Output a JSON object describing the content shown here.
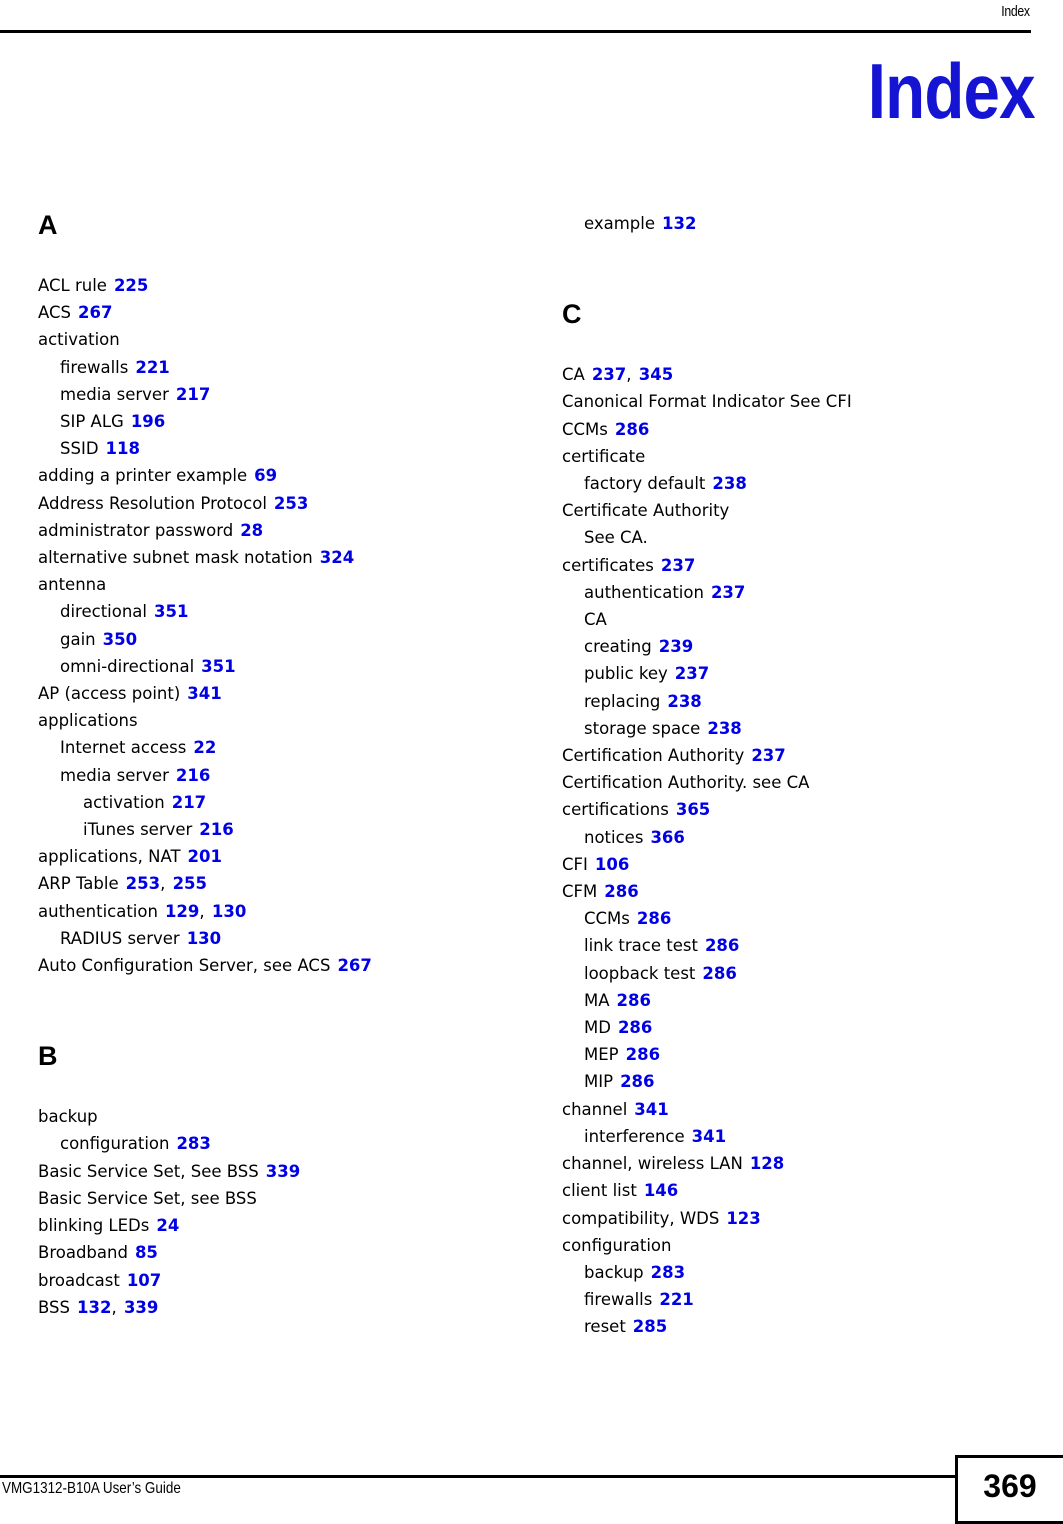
{
  "header": {
    "running_title": "Index"
  },
  "title": "Index",
  "footer": {
    "guide_name": "VMG1312-B10A User’s Guide",
    "page_number": "369"
  },
  "columns": [
    {
      "name": "left-column",
      "groups": [
        {
          "letter": "A",
          "first": true,
          "entries": [
            {
              "level": 1,
              "term": "ACL rule",
              "pages": [
                "225"
              ]
            },
            {
              "level": 1,
              "term": "ACS",
              "pages": [
                "267"
              ]
            },
            {
              "level": 1,
              "term": "activation",
              "pages": []
            },
            {
              "level": 2,
              "term": "firewalls",
              "pages": [
                "221"
              ]
            },
            {
              "level": 2,
              "term": "media server",
              "pages": [
                "217"
              ]
            },
            {
              "level": 2,
              "term": "SIP ALG",
              "pages": [
                "196"
              ]
            },
            {
              "level": 2,
              "term": "SSID",
              "pages": [
                "118"
              ]
            },
            {
              "level": 1,
              "term": "adding a printer example",
              "pages": [
                "69"
              ]
            },
            {
              "level": 1,
              "term": "Address Resolution Protocol",
              "pages": [
                "253"
              ]
            },
            {
              "level": 1,
              "term": "administrator password",
              "pages": [
                "28"
              ]
            },
            {
              "level": 1,
              "term": "alternative subnet mask notation",
              "pages": [
                "324"
              ]
            },
            {
              "level": 1,
              "term": "antenna",
              "pages": []
            },
            {
              "level": 2,
              "term": "directional",
              "pages": [
                "351"
              ]
            },
            {
              "level": 2,
              "term": "gain",
              "pages": [
                "350"
              ]
            },
            {
              "level": 2,
              "term": "omni-directional",
              "pages": [
                "351"
              ]
            },
            {
              "level": 1,
              "term": "AP (access point)",
              "pages": [
                "341"
              ]
            },
            {
              "level": 1,
              "term": "applications",
              "pages": []
            },
            {
              "level": 2,
              "term": "Internet access",
              "pages": [
                "22"
              ]
            },
            {
              "level": 2,
              "term": "media server",
              "pages": [
                "216"
              ]
            },
            {
              "level": 3,
              "term": "activation",
              "pages": [
                "217"
              ]
            },
            {
              "level": 3,
              "term": "iTunes server",
              "pages": [
                "216"
              ]
            },
            {
              "level": 1,
              "term": "applications, NAT",
              "pages": [
                "201"
              ]
            },
            {
              "level": 1,
              "term": "ARP Table",
              "pages": [
                "253",
                "255"
              ]
            },
            {
              "level": 1,
              "term": "authentication",
              "pages": [
                "129",
                "130"
              ]
            },
            {
              "level": 2,
              "term": "RADIUS server",
              "pages": [
                "130"
              ]
            },
            {
              "level": 1,
              "term": "Auto Configuration Server, see ACS",
              "pages": [
                "267"
              ]
            }
          ]
        },
        {
          "letter": "B",
          "first": false,
          "entries": [
            {
              "level": 1,
              "term": "backup",
              "pages": []
            },
            {
              "level": 2,
              "term": "configuration",
              "pages": [
                "283"
              ]
            },
            {
              "level": 1,
              "term": "Basic Service Set, See BSS",
              "pages": [
                "339"
              ]
            },
            {
              "level": 1,
              "term": "Basic Service Set, see BSS",
              "pages": []
            },
            {
              "level": 1,
              "term": "blinking LEDs",
              "pages": [
                "24"
              ]
            },
            {
              "level": 1,
              "term": "Broadband",
              "pages": [
                "85"
              ]
            },
            {
              "level": 1,
              "term": "broadcast",
              "pages": [
                "107"
              ]
            },
            {
              "level": 1,
              "term": "BSS",
              "pages": [
                "132",
                "339"
              ]
            }
          ]
        }
      ]
    },
    {
      "name": "right-column",
      "groups": [
        {
          "letter": "",
          "first": true,
          "entries": [
            {
              "level": 2,
              "term": "example",
              "pages": [
                "132"
              ]
            }
          ]
        },
        {
          "letter": "C",
          "first": false,
          "entries": [
            {
              "level": 1,
              "term": "CA",
              "pages": [
                "237",
                "345"
              ]
            },
            {
              "level": 1,
              "term": "Canonical Format Indicator See CFI",
              "pages": []
            },
            {
              "level": 1,
              "term": "CCMs",
              "pages": [
                "286"
              ]
            },
            {
              "level": 1,
              "term": "certificate",
              "pages": []
            },
            {
              "level": 2,
              "term": "factory default",
              "pages": [
                "238"
              ]
            },
            {
              "level": 1,
              "term": "Certificate Authority",
              "pages": []
            },
            {
              "level": 2,
              "term": "See CA.",
              "pages": []
            },
            {
              "level": 1,
              "term": "certificates",
              "pages": [
                "237"
              ]
            },
            {
              "level": 2,
              "term": "authentication",
              "pages": [
                "237"
              ]
            },
            {
              "level": 2,
              "term": "CA",
              "pages": []
            },
            {
              "level": 2,
              "term": "creating",
              "pages": [
                "239"
              ]
            },
            {
              "level": 2,
              "term": "public key",
              "pages": [
                "237"
              ]
            },
            {
              "level": 2,
              "term": "replacing",
              "pages": [
                "238"
              ]
            },
            {
              "level": 2,
              "term": "storage space",
              "pages": [
                "238"
              ]
            },
            {
              "level": 1,
              "term": "Certification Authority",
              "pages": [
                "237"
              ]
            },
            {
              "level": 1,
              "term": "Certification Authority. see CA",
              "pages": []
            },
            {
              "level": 1,
              "term": "certifications",
              "pages": [
                "365"
              ]
            },
            {
              "level": 2,
              "term": "notices",
              "pages": [
                "366"
              ]
            },
            {
              "level": 1,
              "term": "CFI",
              "pages": [
                "106"
              ]
            },
            {
              "level": 1,
              "term": "CFM",
              "pages": [
                "286"
              ]
            },
            {
              "level": 2,
              "term": "CCMs",
              "pages": [
                "286"
              ]
            },
            {
              "level": 2,
              "term": "link trace test",
              "pages": [
                "286"
              ]
            },
            {
              "level": 2,
              "term": "loopback test",
              "pages": [
                "286"
              ]
            },
            {
              "level": 2,
              "term": "MA",
              "pages": [
                "286"
              ]
            },
            {
              "level": 2,
              "term": "MD",
              "pages": [
                "286"
              ]
            },
            {
              "level": 2,
              "term": "MEP",
              "pages": [
                "286"
              ]
            },
            {
              "level": 2,
              "term": "MIP",
              "pages": [
                "286"
              ]
            },
            {
              "level": 1,
              "term": "channel",
              "pages": [
                "341"
              ]
            },
            {
              "level": 2,
              "term": "interference",
              "pages": [
                "341"
              ]
            },
            {
              "level": 1,
              "term": "channel, wireless LAN",
              "pages": [
                "128"
              ]
            },
            {
              "level": 1,
              "term": "client list",
              "pages": [
                "146"
              ]
            },
            {
              "level": 1,
              "term": "compatibility, WDS",
              "pages": [
                "123"
              ]
            },
            {
              "level": 1,
              "term": "configuration",
              "pages": []
            },
            {
              "level": 2,
              "term": "backup",
              "pages": [
                "283"
              ]
            },
            {
              "level": 2,
              "term": "firewalls",
              "pages": [
                "221"
              ]
            },
            {
              "level": 2,
              "term": "reset",
              "pages": [
                "285"
              ]
            }
          ]
        }
      ]
    }
  ]
}
